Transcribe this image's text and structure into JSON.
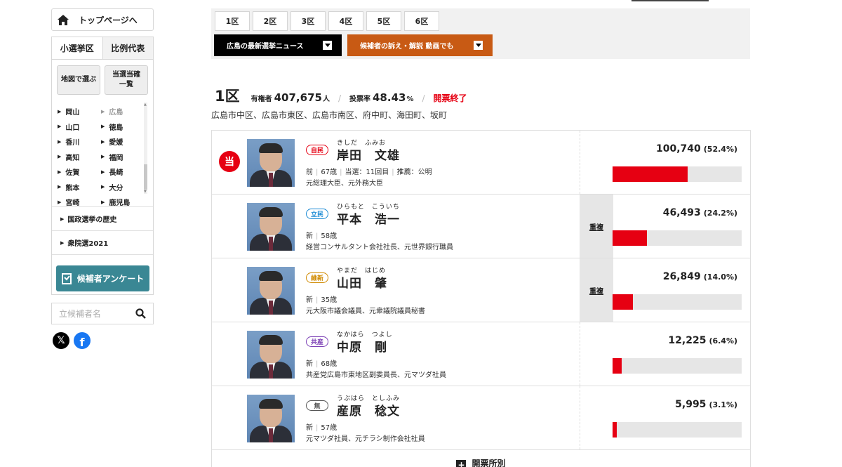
{
  "sidebar": {
    "top_link": "トップページへ",
    "tabs": [
      "小選挙区",
      "比例代表"
    ],
    "buttons": [
      "地図で選ぶ",
      "当選当確\n一覧"
    ],
    "prefectures": [
      "岡山",
      "広島",
      "山口",
      "徳島",
      "香川",
      "愛媛",
      "高知",
      "福岡",
      "佐賀",
      "長崎",
      "熊本",
      "大分",
      "宮崎",
      "鹿児島"
    ],
    "current_prefecture": "広島",
    "links": [
      "国政選挙の歴史",
      "衆院選2021"
    ],
    "survey_button": "候補者アンケート",
    "search_placeholder": "立候補者名"
  },
  "districts": [
    "1区",
    "2区",
    "3区",
    "4区",
    "5区",
    "6区"
  ],
  "news_buttons": [
    {
      "label": "広島の最新選挙ニュース",
      "color": "#000000"
    },
    {
      "label": "候補者の訴え・解説 動画でも",
      "color": "#c85a14"
    }
  ],
  "summary": {
    "district": "1区",
    "electorate_label": "有権者",
    "electorate": "407,675",
    "electorate_unit": "人",
    "turnout_label": "投票率",
    "turnout": "48.43",
    "turnout_unit": "%",
    "status": "開票終了",
    "areas": "広島市中区、広島市東区、広島市南区、府中町、海田町、坂町"
  },
  "candidates": [
    {
      "winner": true,
      "win_mark": "当",
      "party": "自民",
      "party_color": "#e60012",
      "kana": "きしだ　ふみお",
      "name": "岸田　文雄",
      "info": [
        "前",
        "67歳",
        "当選：11回目",
        "推薦：公明"
      ],
      "career": "元総理大臣、元外務大臣",
      "dup": "",
      "votes": "100,740",
      "pct": "(52.4%)",
      "share": 0.524
    },
    {
      "winner": false,
      "party": "立民",
      "party_color": "#1a8ad4",
      "kana": "ひらもと　こういち",
      "name": "平本　浩一",
      "info": [
        "新",
        "58歳"
      ],
      "career": "経営コンサルタント会社社長、元世界銀行職員",
      "dup": "重複",
      "votes": "46,493",
      "pct": "(24.2%)",
      "share": 0.242
    },
    {
      "winner": false,
      "party": "維新",
      "party_color": "#d08a00",
      "kana": "やまだ　はじめ",
      "name": "山田　肇",
      "info": [
        "新",
        "35歳"
      ],
      "career": "元大阪市議会議員、元衆議院議員秘書",
      "dup": "重複",
      "votes": "26,849",
      "pct": "(14.0%)",
      "share": 0.14
    },
    {
      "winner": false,
      "party": "共産",
      "party_color": "#7b3fb5",
      "kana": "なかはら　つよし",
      "name": "中原　剛",
      "info": [
        "新",
        "68歳"
      ],
      "career": "共産党広島市東地区副委員長、元マツダ社員",
      "dup": "",
      "votes": "12,225",
      "pct": "(6.4%)",
      "share": 0.064
    },
    {
      "winner": false,
      "party": "無",
      "party_color": "#555555",
      "kana": "うぶはら　としふみ",
      "name": "産原　稔文",
      "info": [
        "新",
        "57歳"
      ],
      "career": "元マツダ社員、元チラシ制作会社社員",
      "dup": "",
      "votes": "5,995",
      "pct": "(3.1%)",
      "share": 0.031
    }
  ],
  "more_label": "開票所別"
}
